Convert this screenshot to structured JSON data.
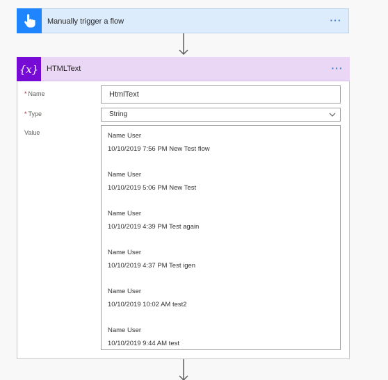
{
  "trigger": {
    "title": "Manually trigger a flow",
    "icon": "hand-touch-icon",
    "more": "···"
  },
  "variable_card": {
    "title": "HTMLText",
    "icon": "variable-x-icon",
    "icon_text": "{x}",
    "more": "···",
    "fields": {
      "name_label": "Name",
      "name_value": "HtmlText",
      "type_label": "Type",
      "type_value": "String",
      "value_label": "Value",
      "required_marker": "*"
    },
    "value_lines": [
      "Name User",
      "10/10/2019 7:56 PM New Test flow",
      "",
      "Name User",
      "10/10/2019 5:06 PM New Test",
      "",
      "Name User",
      "10/10/2019 4:39 PM Test again",
      "",
      "Name User",
      "10/10/2019 4:37 PM Test igen",
      "",
      "Name User",
      "10/10/2019 10:02 AM test2",
      "",
      "Name User",
      "10/10/2019 9:44 AM test"
    ]
  },
  "colors": {
    "trigger_bg": "#dcecfc",
    "trigger_accent": "#1f85ff",
    "variable_bg": "#ead7f5",
    "variable_accent": "#770bd6",
    "more_dots": "#3b7fd1",
    "required": "#a4262c"
  }
}
